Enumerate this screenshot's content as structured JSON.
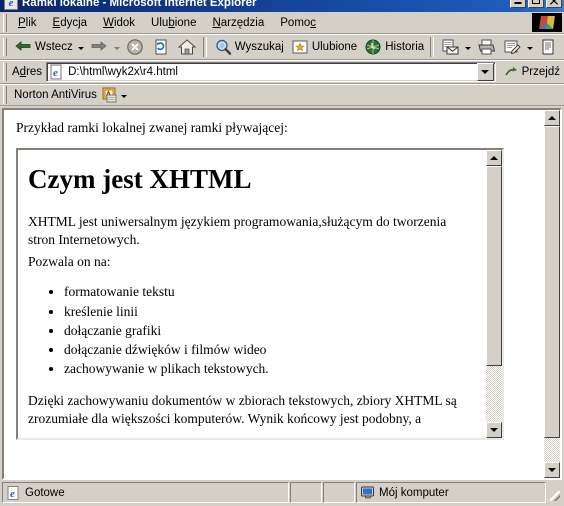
{
  "window": {
    "title": "Ramki lokalne - Microsoft Internet Explorer",
    "icon": "ie-document-icon",
    "buttons": {
      "minimize": "minimize-button",
      "maximize": "maximize-button",
      "close": "close-button"
    }
  },
  "menubar": {
    "items": [
      {
        "label": "Plik",
        "accel": "P"
      },
      {
        "label": "Edycja",
        "accel": "E"
      },
      {
        "label": "Widok",
        "accel": "W"
      },
      {
        "label": "Ulubione",
        "accel": "b"
      },
      {
        "label": "Narzędzia",
        "accel": "N"
      },
      {
        "label": "Pomoc",
        "accel": "c"
      }
    ]
  },
  "toolbar": {
    "back": "Wstecz",
    "forward": "",
    "stop": "",
    "refresh": "",
    "home": "",
    "search": "Wyszukaj",
    "favorites": "Ulubione",
    "history": "Historia",
    "mail": "",
    "print": "",
    "edit": "",
    "discuss": ""
  },
  "address": {
    "label": "Adres",
    "value": "D:\\html\\wyk2x\\r4.html",
    "go_label": "Przejdź"
  },
  "norton": {
    "label": "Norton AntiVirus"
  },
  "page": {
    "intro": "Przykład ramki lokalnej zwanej ramki pływającej:",
    "iframe": {
      "heading": "Czym jest XHTML",
      "paragraph1": "XHTML jest uniwersalnym językiem programowania,służącym do tworzenia stron Internetowych.",
      "paragraph2": "Pozwala on na:",
      "list": [
        "formatowanie tekstu",
        "kreślenie linii",
        "dołączanie grafiki",
        "dołączanie dźwięków i filmów wideo",
        "zachowywanie w plikach tekstowych."
      ],
      "paragraph3": "Dzięki zachowywaniu dokumentów w zbiorach tekstowych, zbiory XHTML są zrozumiałe dla większości komputerów. Wynik końcowy jest podobny, a"
    }
  },
  "statusbar": {
    "status": "Gotowe",
    "zone": "Mój komputer"
  },
  "colors": {
    "titlebar_start": "#0a246a",
    "titlebar_end": "#3a80d0",
    "face": "#d4d0c8",
    "page_bg": "#ffffff"
  }
}
